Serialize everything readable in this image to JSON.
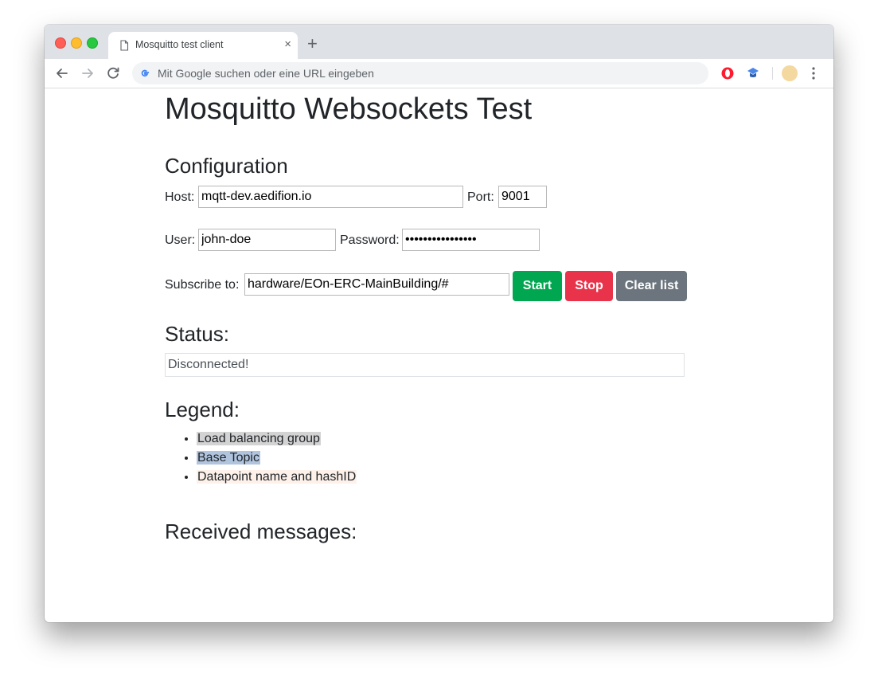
{
  "browser": {
    "tab_title": "Mosquitto test client",
    "tab_close": "×",
    "new_tab": "+",
    "omnibox_placeholder": "Mit Google suchen oder eine URL eingeben"
  },
  "page": {
    "title": "Mosquitto Websockets Test",
    "config_heading": "Configuration",
    "host_label": "Host:",
    "host_value": "mqtt-dev.aedifion.io",
    "port_label": "Port:",
    "port_value": "9001",
    "user_label": "User:",
    "user_value": "john-doe",
    "password_label": "Password:",
    "password_value": "••••••••••••••••",
    "subscribe_label": "Subscribe to:",
    "subscribe_value": "hardware/EOn-ERC-MainBuilding/#",
    "start_label": "Start",
    "stop_label": "Stop",
    "clear_label": "Clear list",
    "status_heading": "Status:",
    "status_text": "Disconnected!",
    "legend_heading": "Legend:",
    "legend_items": [
      {
        "label": "Load balancing group",
        "color": "#d3d3d3"
      },
      {
        "label": "Base Topic",
        "color": "#b0c4de"
      },
      {
        "label": "Datapoint name and hashID",
        "color": "#fdf1ea"
      }
    ],
    "received_heading": "Received messages:"
  },
  "colors": {
    "start": "#00a650",
    "stop": "#e8334a",
    "clear": "#6c757d"
  }
}
